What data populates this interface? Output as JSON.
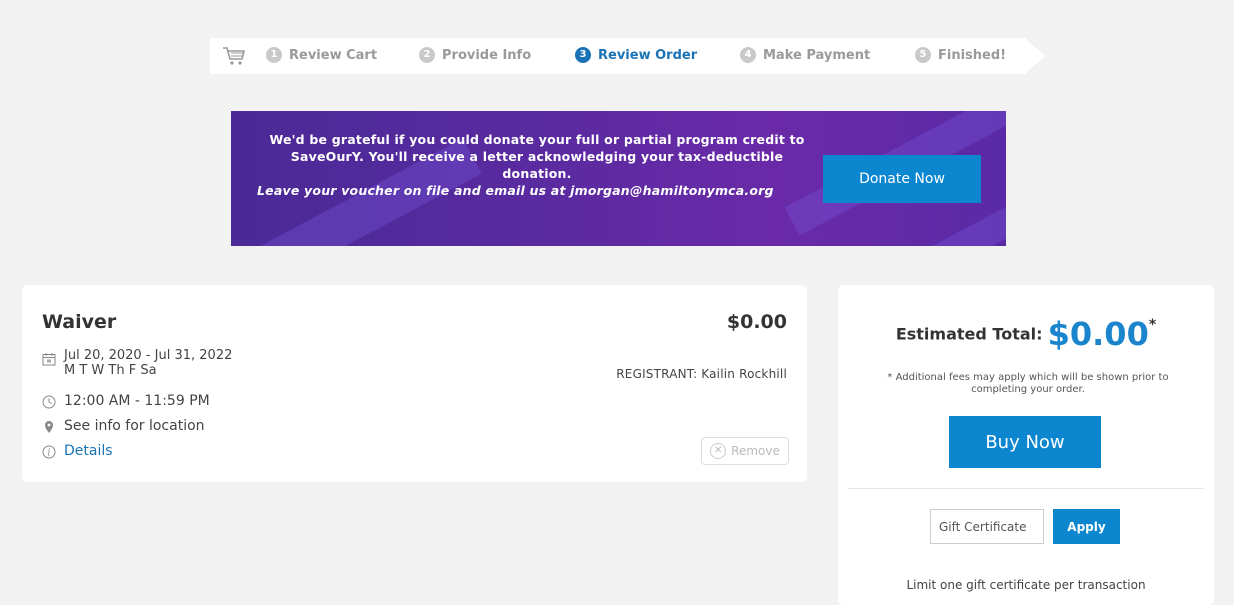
{
  "progress": {
    "cart_icon": "cart-icon",
    "steps": [
      {
        "num": "1",
        "label": "Review Cart"
      },
      {
        "num": "2",
        "label": "Provide Info"
      },
      {
        "num": "3",
        "label": "Review Order"
      },
      {
        "num": "4",
        "label": "Make Payment"
      },
      {
        "num": "5",
        "label": "Finished!"
      }
    ],
    "active_step": 3
  },
  "banner": {
    "line1": "We'd be grateful if you could donate your full or partial program credit to SaveOurY. You'll receive a letter acknowledging your tax-deductible donation.",
    "line2": "Leave your voucher on file and email us at jmorgan@hamiltonymca.org",
    "donate_label": "Donate Now"
  },
  "cart_item": {
    "title": "Waiver",
    "price": "$0.00",
    "dates": "Jul 20, 2020 - Jul 31, 2022",
    "days": "M T W Th F Sa",
    "time": "12:00 AM - 11:59 PM",
    "location": "See info for location",
    "details_label": "Details",
    "registrant": "REGISTRANT: Kailin Rockhill",
    "remove_label": "Remove"
  },
  "summary": {
    "estimated_label": "Estimated Total:",
    "estimated_value": "$0.00",
    "asterisk": "*",
    "fees_note": "* Additional fees may apply which will be shown prior to completing your order.",
    "buy_label": "Buy Now",
    "gift_placeholder": "Gift Certificate",
    "apply_label": "Apply",
    "limit_note": "Limit one gift certificate per transaction"
  },
  "colors": {
    "accent": "#0b86cf",
    "active_step": "#1a73b5",
    "banner_purple": "#5a2aa0"
  }
}
